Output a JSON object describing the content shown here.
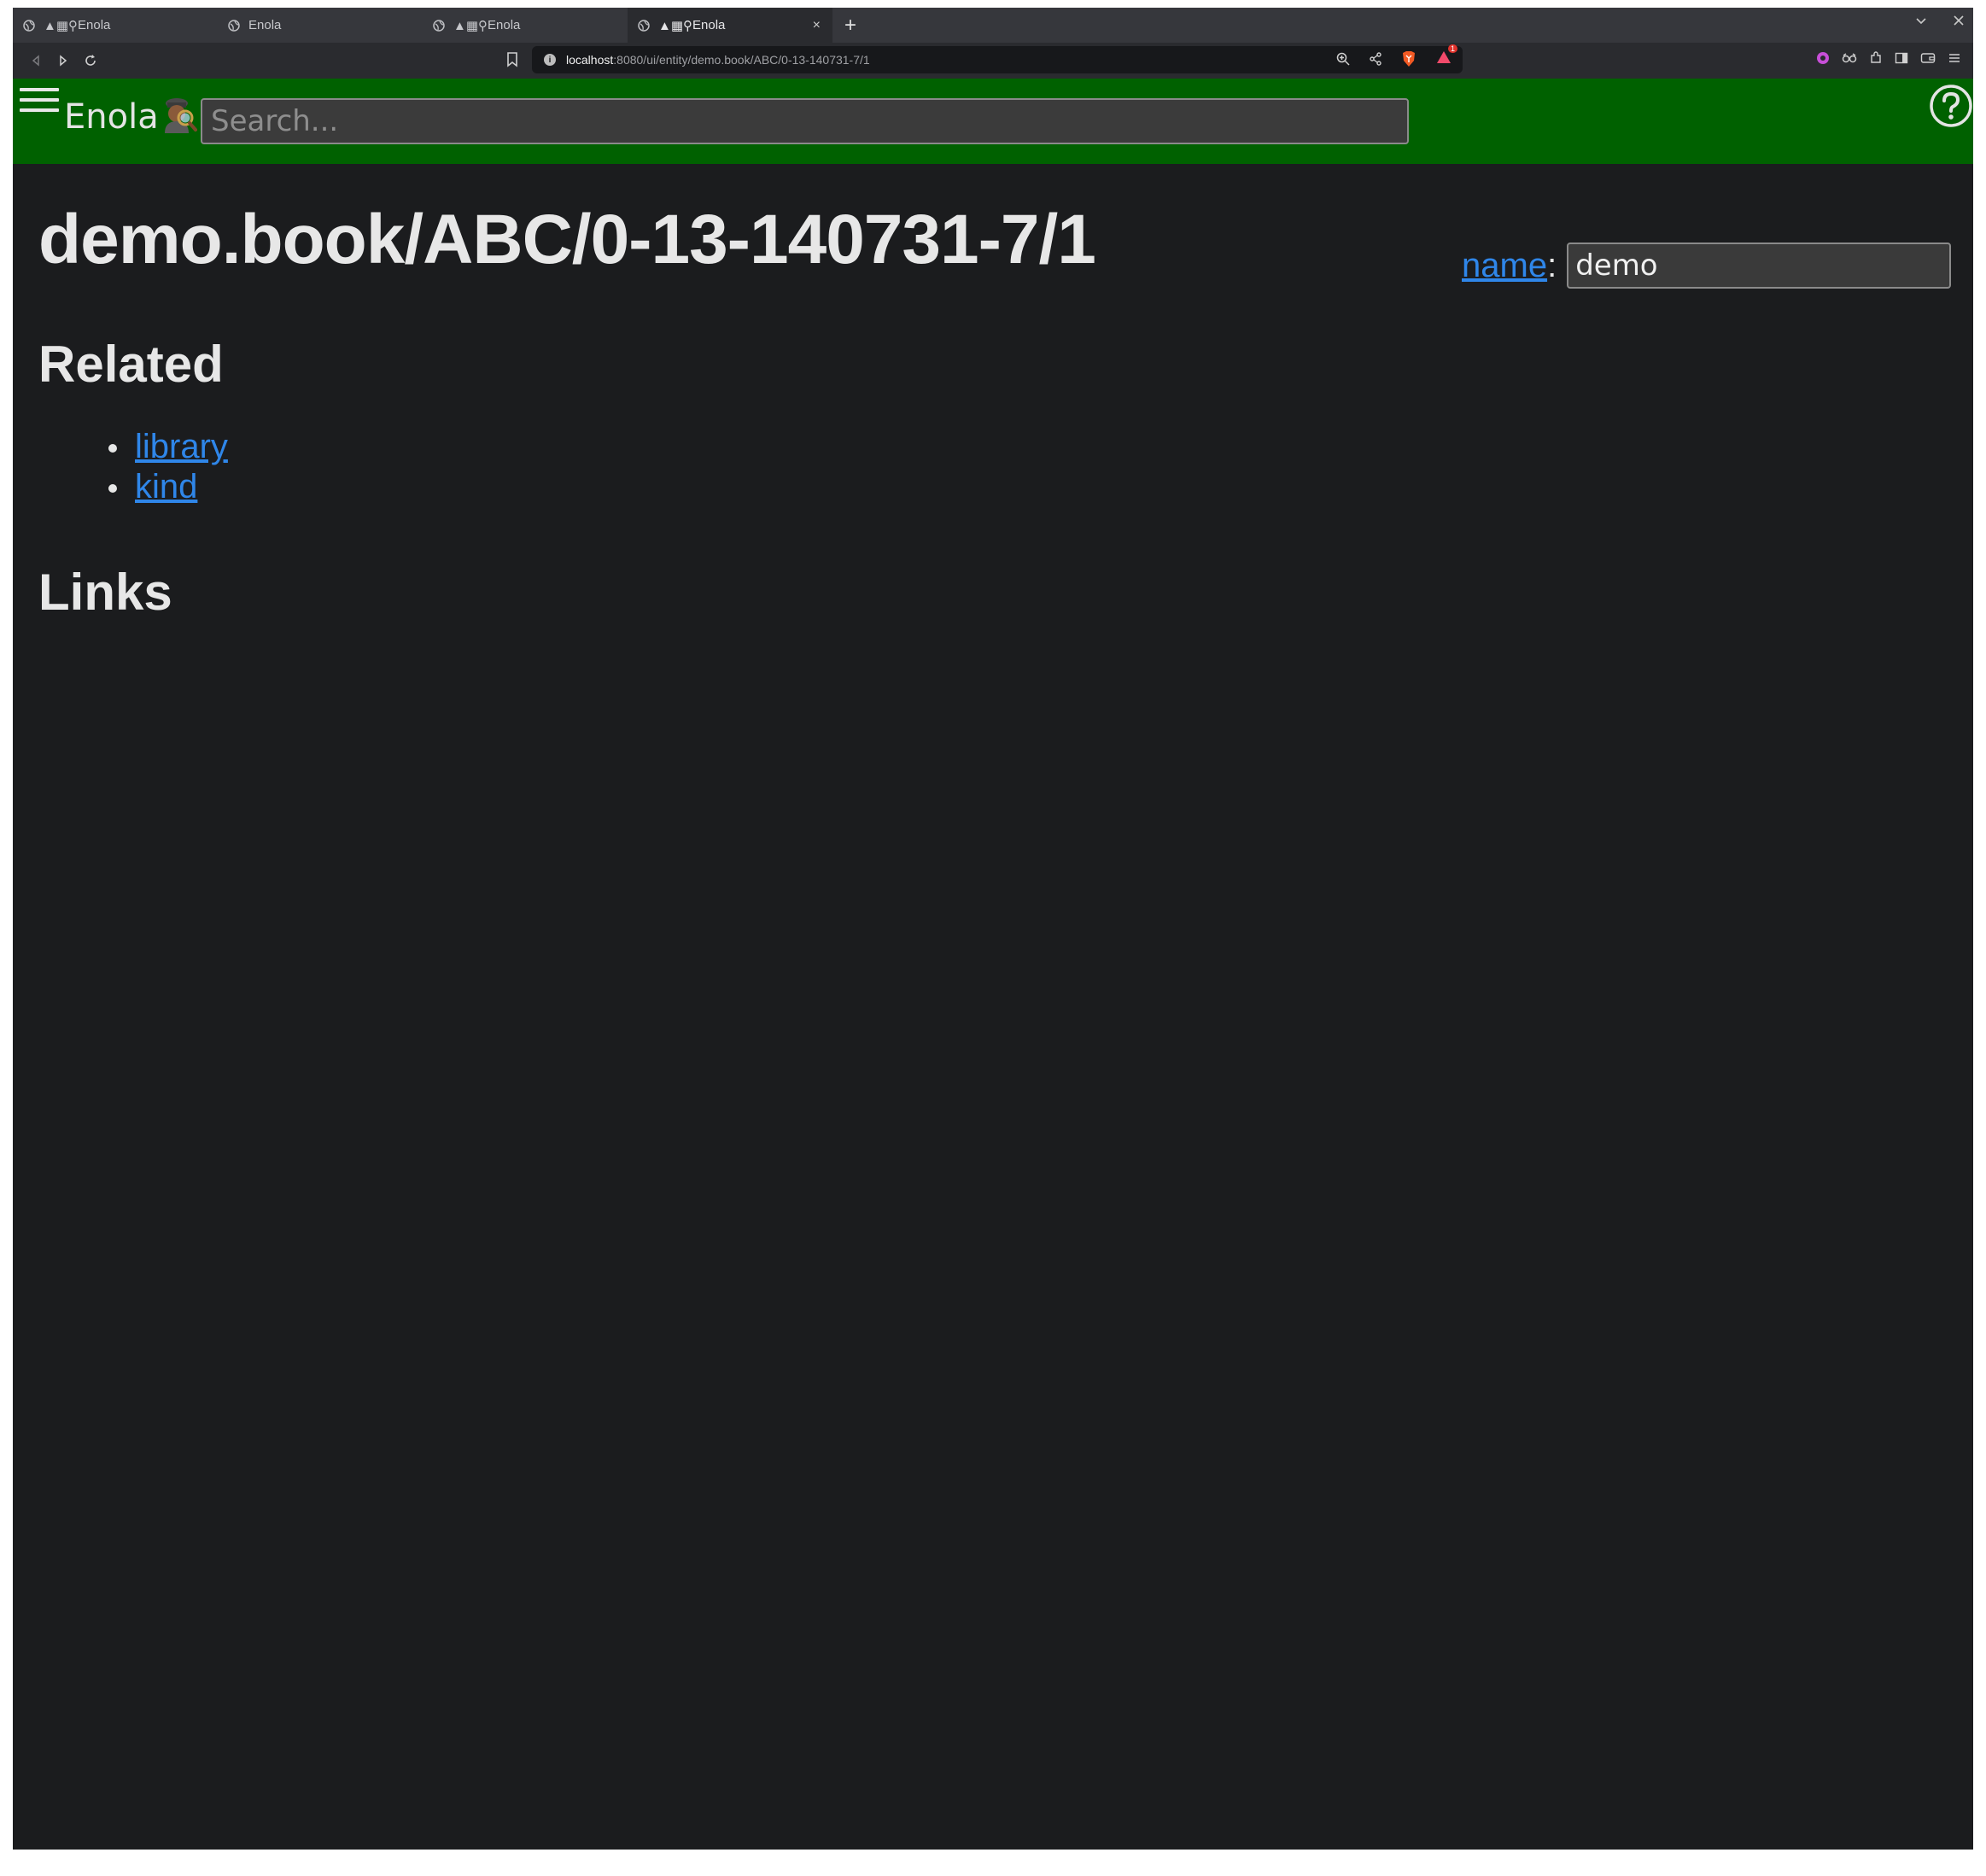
{
  "browser": {
    "tabs": [
      {
        "prefix": "▲▦⚲",
        "label": "Enola",
        "active": false
      },
      {
        "prefix": "",
        "label": "Enola",
        "active": false
      },
      {
        "prefix": "▲▦⚲",
        "label": "Enola",
        "active": false
      },
      {
        "prefix": "▲▦⚲",
        "label": "Enola",
        "active": true
      }
    ],
    "new_tab_label": "+",
    "close_tab_label": "×",
    "url_host": "localhost",
    "url_rest": ":8080/ui/entity/demo.book/ABC/0-13-140731-7/1",
    "shields_badge": "1",
    "accent_brave": "#f25a24"
  },
  "app": {
    "brand": "Enola",
    "search_placeholder": "Search...",
    "header_color": "#006100",
    "link_color": "#2f86e9"
  },
  "entity": {
    "title": "demo.book/ABC/0-13-140731-7/1",
    "name_label": "name",
    "name_colon": ":",
    "name_value": "demo"
  },
  "sections": {
    "related_heading": "Related",
    "related_items": [
      "library",
      "kind"
    ],
    "links_heading": "Links"
  }
}
